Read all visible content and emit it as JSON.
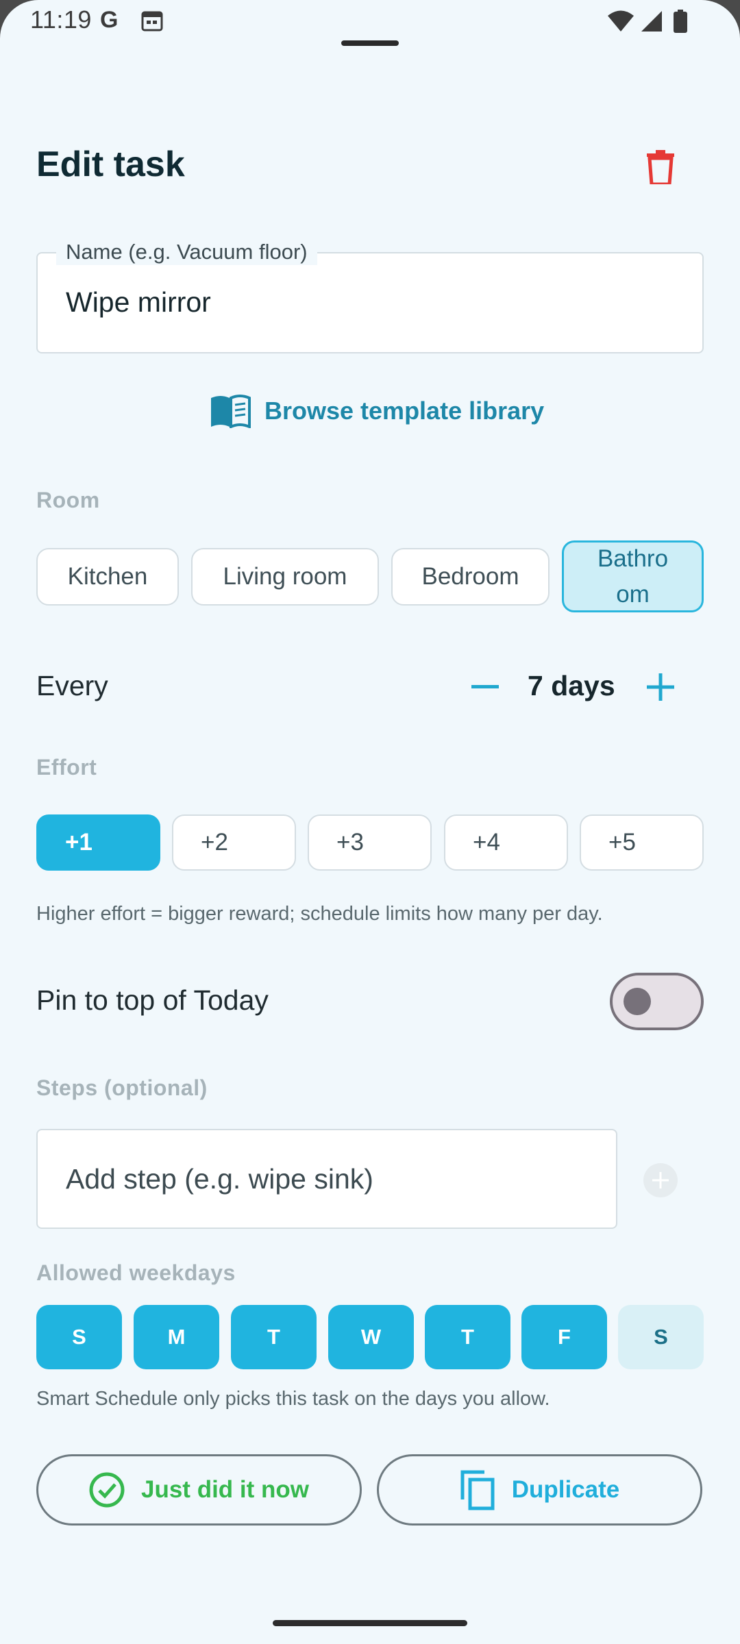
{
  "status_bar": {
    "time": "11:19",
    "g_letter": "G",
    "icons": [
      "google-icon",
      "calendar-icon",
      "wifi-icon",
      "signal-icon",
      "battery-icon"
    ]
  },
  "header": {
    "title": "Edit task",
    "delete_icon": "trash-icon"
  },
  "name_field": {
    "label": "Name (e.g. Vacuum floor)",
    "value": "Wipe mirror"
  },
  "browse": {
    "label": "Browse template library",
    "icon": "book-icon"
  },
  "room": {
    "label": "Room",
    "chips": [
      "Kitchen",
      "Living room",
      "Bedroom",
      "Bathroom"
    ],
    "selected_display": "Bathro\nom",
    "selected": "Bathroom"
  },
  "every": {
    "label": "Every",
    "value": "7 days"
  },
  "effort": {
    "label": "Effort",
    "options": [
      "+1",
      "+2",
      "+3",
      "+4",
      "+5"
    ],
    "selected": "+1",
    "hint": "Higher effort = bigger reward; schedule limits how many per day."
  },
  "pin": {
    "label": "Pin to top of Today",
    "enabled": false
  },
  "steps": {
    "label": "Steps (optional)",
    "placeholder": "Add step (e.g. wipe sink)"
  },
  "weekdays": {
    "label": "Allowed weekdays",
    "days": [
      "S",
      "M",
      "T",
      "W",
      "T",
      "F",
      "S"
    ],
    "enabled": [
      true,
      true,
      true,
      true,
      true,
      true,
      false
    ],
    "hint": "Smart Schedule only picks this task on the days you allow."
  },
  "actions": {
    "just_did": "Just did it now",
    "duplicate": "Duplicate"
  },
  "colors": {
    "accent": "#20b4df",
    "danger": "#e53935",
    "success": "#36b84e",
    "background": "#f1f8fc"
  }
}
